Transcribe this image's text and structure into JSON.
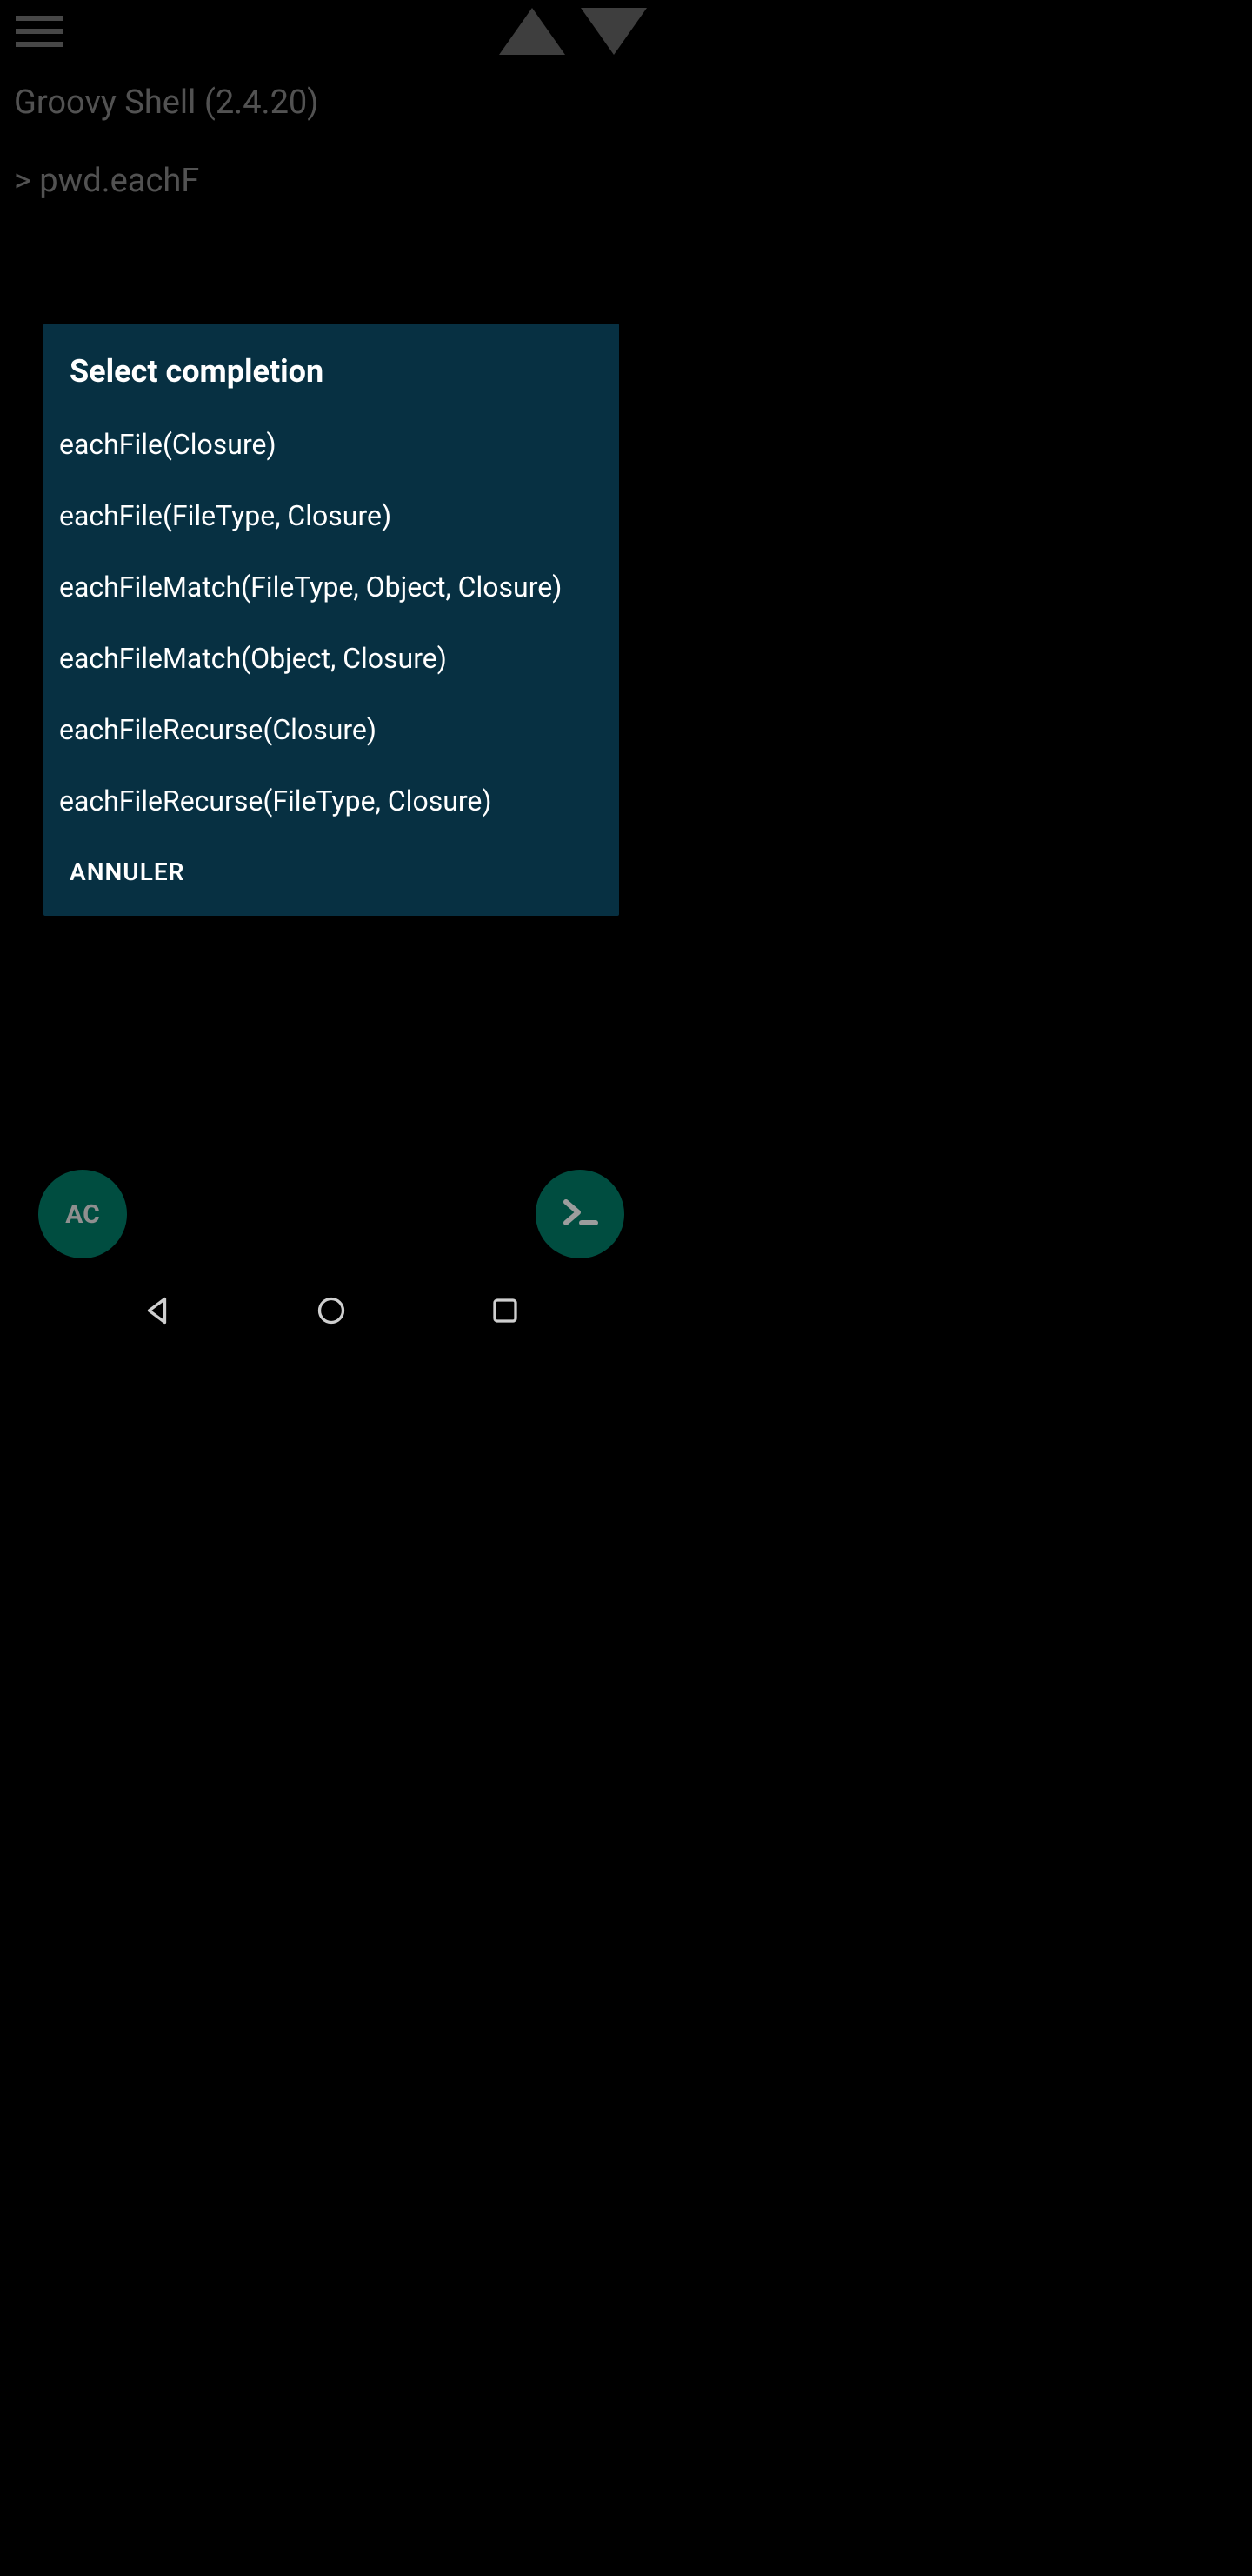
{
  "shell": {
    "title": "Groovy Shell (2.4.20)",
    "prompt": "> pwd.eachF"
  },
  "dialog": {
    "title": "Select completion",
    "items": [
      "eachFile(Closure)",
      "eachFile(FileType, Closure)",
      "eachFileMatch(FileType, Object, Closure)",
      "eachFileMatch(Object, Closure)",
      "eachFileRecurse(Closure)",
      "eachFileRecurse(FileType, Closure)"
    ],
    "cancel": "ANNULER"
  },
  "fab": {
    "ac": "AC"
  }
}
